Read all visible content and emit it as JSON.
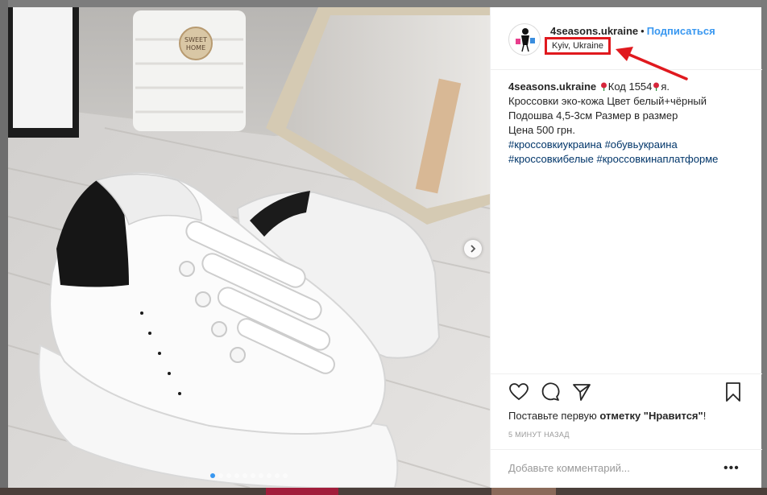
{
  "post": {
    "username": "4seasons.ukraine",
    "separator": "•",
    "follow_label": "Подписаться",
    "location": "Kyiv, Ukraine",
    "caption": {
      "username": "4seasons.ukraine",
      "line1_a": "Код 1554",
      "line1_b": "я.",
      "line2": "Кроссовки эко-кожа Цвет белый+чёрный",
      "line3": "Подошва 4,5-3см Размер в размер",
      "line4": "Цена 500 грн.",
      "hashtags_line1": [
        "#кроссовкиукраина",
        "#обувьукраина"
      ],
      "hashtags_line2": [
        "#кроссовкибелые",
        "#кроссовкинаплатформе"
      ]
    },
    "likes": {
      "prefix": "Поставьте первую ",
      "bold": "отметку \"Нравится\"",
      "suffix": "!"
    },
    "timestamp": "5 МИНУТ НАЗАД",
    "comment_placeholder": "Добавьте комментарий...",
    "more_label": "•••"
  },
  "carousel": {
    "dot_count": 10,
    "active_index": 0
  },
  "icons": {
    "heart": "heart-icon",
    "comment": "comment-icon",
    "share": "share-icon",
    "save": "bookmark-icon",
    "next": "chevron-right-icon"
  },
  "colors": {
    "accent": "#3897f0",
    "hashtag": "#003569",
    "annotation": "#e0191e"
  }
}
